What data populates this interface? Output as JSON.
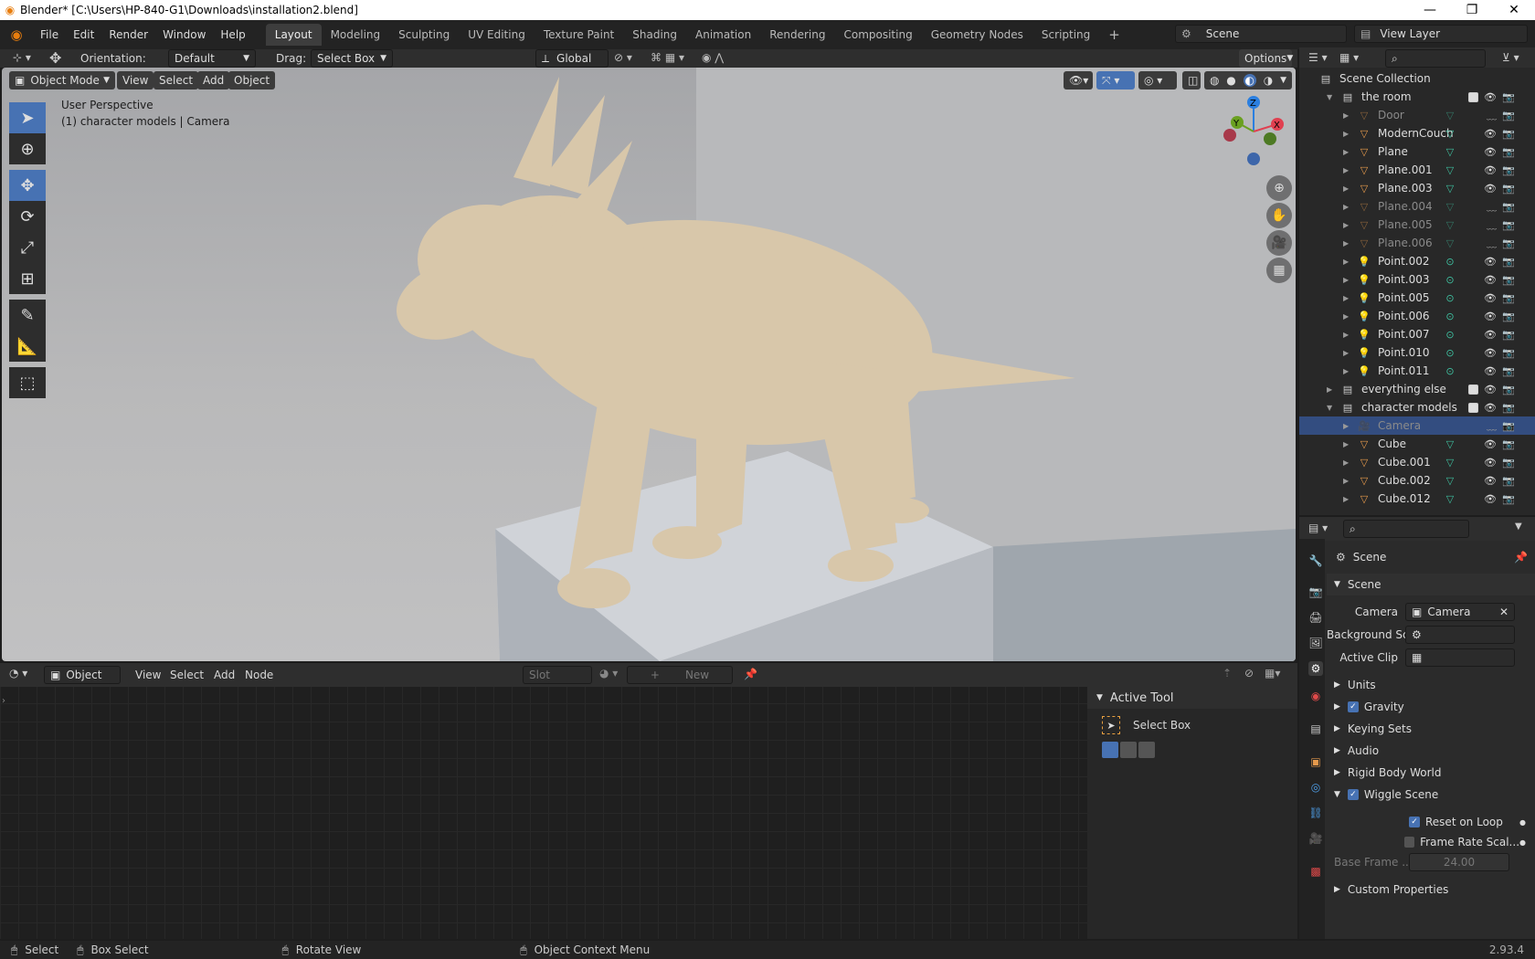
{
  "window": {
    "title": "Blender* [C:\\Users\\HP-840-G1\\Downloads\\installation2.blend]",
    "min": "—",
    "max": "❐",
    "close": "✕"
  },
  "menus": [
    "File",
    "Edit",
    "Render",
    "Window",
    "Help"
  ],
  "workspaces": [
    "Layout",
    "Modeling",
    "Sculpting",
    "UV Editing",
    "Texture Paint",
    "Shading",
    "Animation",
    "Rendering",
    "Compositing",
    "Geometry Nodes",
    "Scripting"
  ],
  "scene": {
    "label": "Scene",
    "view_layer": "View Layer"
  },
  "toolheader": {
    "orientation_label": "Orientation:",
    "orientation_value": "Default",
    "drag_label": "Drag:",
    "drag_value": "Select Box",
    "transform": "Global",
    "options": "Options"
  },
  "viewport": {
    "mode": "Object Mode",
    "view": "View",
    "select": "Select",
    "add": "Add",
    "object": "Object",
    "info1": "User Perspective",
    "info2": "(1) character models | Camera"
  },
  "gizmo": {
    "x": "X",
    "y": "Y",
    "z": "Z"
  },
  "nodeeditor": {
    "type": "Object",
    "view": "View",
    "select": "Select",
    "add": "Add",
    "node": "Node",
    "slot": "Slot",
    "new": "New"
  },
  "activetool": {
    "title": "Active Tool",
    "tool": "Select Box"
  },
  "outliner": {
    "root": "Scene Collection",
    "rows": [
      {
        "label": "the room",
        "kind": "collection",
        "indent": 1,
        "expanded": true,
        "dim": false
      },
      {
        "label": "Door",
        "kind": "mesh",
        "indent": 2,
        "dim": true
      },
      {
        "label": "ModernCouch",
        "kind": "mesh",
        "indent": 2,
        "dim": false
      },
      {
        "label": "Plane",
        "kind": "mesh",
        "indent": 2,
        "dim": false
      },
      {
        "label": "Plane.001",
        "kind": "mesh",
        "indent": 2,
        "dim": false
      },
      {
        "label": "Plane.003",
        "kind": "mesh",
        "indent": 2,
        "dim": false
      },
      {
        "label": "Plane.004",
        "kind": "mesh",
        "indent": 2,
        "dim": true
      },
      {
        "label": "Plane.005",
        "kind": "mesh",
        "indent": 2,
        "dim": true
      },
      {
        "label": "Plane.006",
        "kind": "mesh",
        "indent": 2,
        "dim": true
      },
      {
        "label": "Point.002",
        "kind": "light",
        "indent": 2,
        "dim": false
      },
      {
        "label": "Point.003",
        "kind": "light",
        "indent": 2,
        "dim": false
      },
      {
        "label": "Point.005",
        "kind": "light",
        "indent": 2,
        "dim": false
      },
      {
        "label": "Point.006",
        "kind": "light",
        "indent": 2,
        "dim": false
      },
      {
        "label": "Point.007",
        "kind": "light",
        "indent": 2,
        "dim": false
      },
      {
        "label": "Point.010",
        "kind": "light",
        "indent": 2,
        "dim": false
      },
      {
        "label": "Point.011",
        "kind": "light",
        "indent": 2,
        "dim": false
      },
      {
        "label": "everything else",
        "kind": "collection",
        "indent": 1,
        "dim": false
      },
      {
        "label": "character models",
        "kind": "collection",
        "indent": 1,
        "expanded": true,
        "dim": false
      },
      {
        "label": "Camera",
        "kind": "camera",
        "indent": 2,
        "dim": true,
        "selected": true
      },
      {
        "label": "Cube",
        "kind": "mesh",
        "indent": 2,
        "dim": false
      },
      {
        "label": "Cube.001",
        "kind": "mesh",
        "indent": 2,
        "dim": false
      },
      {
        "label": "Cube.002",
        "kind": "mesh",
        "indent": 2,
        "dim": false
      },
      {
        "label": "Cube.012",
        "kind": "mesh",
        "indent": 2,
        "dim": false
      }
    ]
  },
  "properties": {
    "context": "Scene",
    "section": "Scene",
    "camera_label": "Camera",
    "camera_value": "Camera",
    "bg_label": "Background Sc...",
    "clip_label": "Active Clip",
    "panels": [
      "Units",
      "Gravity",
      "Keying Sets",
      "Audio",
      "Rigid Body World",
      "Wiggle Scene"
    ],
    "reset_loop": "Reset on Loop",
    "frame_rate": "Frame Rate Scal...",
    "base_frame_label": "Base Frame ...",
    "base_frame_value": "24.00",
    "custom": "Custom Properties"
  },
  "statusbar": {
    "select": "Select",
    "box_select": "Box Select",
    "rotate": "Rotate View",
    "context_menu": "Object Context Menu",
    "version": "2.93.4"
  },
  "colors": {
    "accent": "#4772b3",
    "mesh": "#e69a4c",
    "light": "#e69a4c",
    "data": "#3ec0a0"
  }
}
